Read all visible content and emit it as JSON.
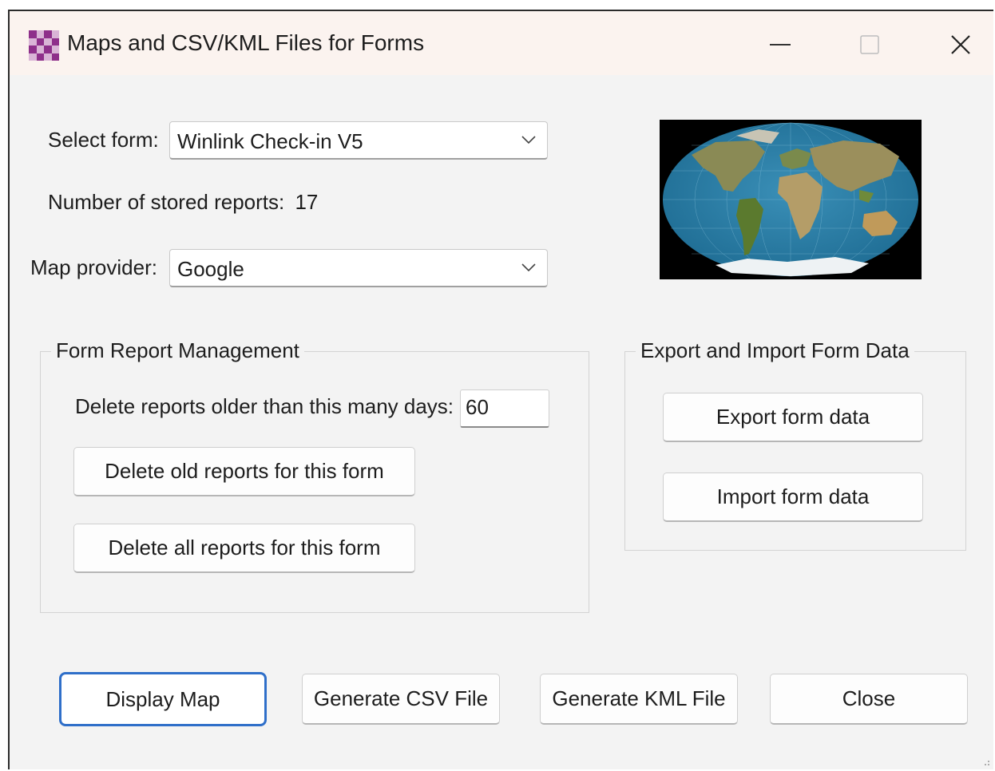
{
  "window": {
    "title": "Maps and CSV/KML Files for Forms"
  },
  "form_select": {
    "label": "Select form:",
    "value": "Winlink Check-in V5"
  },
  "stored_reports": {
    "label": "Number of stored reports:",
    "count": "17"
  },
  "map_provider": {
    "label": "Map provider:",
    "value": "Google"
  },
  "report_management": {
    "title": "Form Report Management",
    "delete_days_label": "Delete reports older than this many days:",
    "delete_days_value": "60",
    "delete_old_button": "Delete old reports for this form",
    "delete_all_button": "Delete all reports for this form"
  },
  "export_import": {
    "title": "Export and Import Form Data",
    "export_button": "Export form data",
    "import_button": "Import form data"
  },
  "footer": {
    "display_map_button": "Display Map",
    "generate_csv_button": "Generate CSV File",
    "generate_kml_button": "Generate KML File",
    "close_button": "Close"
  },
  "colors": {
    "accent_focus": "#2f6fc9",
    "window_bg": "#f3f3f3",
    "icon_purple": "#8e2f8a"
  },
  "icons": [
    "app-checker-icon",
    "minimize-icon",
    "maximize-icon",
    "close-icon",
    "chevron-down-icon",
    "world-map-image",
    "resize-grip-icon"
  ]
}
